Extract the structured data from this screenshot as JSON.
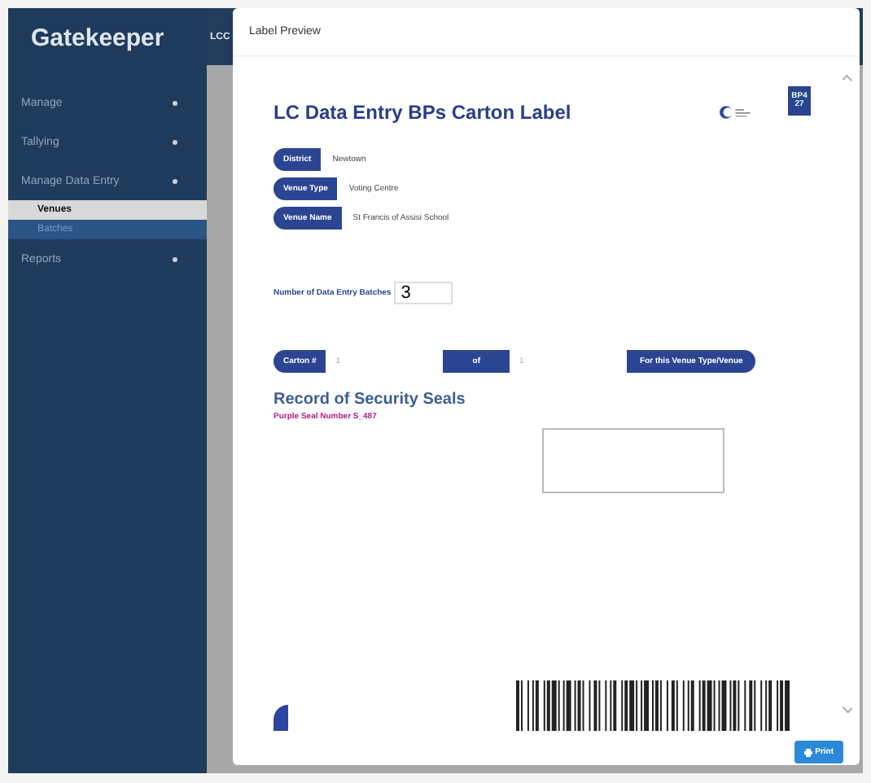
{
  "app": {
    "title": "Gatekeeper",
    "header_text": "LCC"
  },
  "sidebar": {
    "items": [
      {
        "label": "Manage",
        "selected": false
      },
      {
        "label": "Tallying",
        "selected": false
      },
      {
        "label": "Manage Data Entry",
        "selected": false,
        "children": [
          {
            "label": "Venues",
            "selected": true
          },
          {
            "label": "Batches",
            "selected": false
          }
        ]
      },
      {
        "label": "Reports",
        "selected": false
      }
    ]
  },
  "dialog": {
    "title": "Label Preview",
    "label": {
      "heading": "LC Data Entry BPs Carton Label",
      "tag": "BP427",
      "fields": [
        {
          "name": "District",
          "value": "Newtown"
        },
        {
          "name": "Venue Type",
          "value": "Voting Centre"
        },
        {
          "name": "Venue Name",
          "value": "St Francis of Assisi School"
        }
      ],
      "batches": {
        "label": "Number of Data Entry Batches",
        "value": "3"
      },
      "carton": {
        "label": "Carton #",
        "number": "1",
        "of_label": "of",
        "total": "1",
        "note": "For this Venue Type/Venue"
      },
      "seals": {
        "heading": "Record of Security Seals",
        "purple_seal": "Purple Seal Number S_487"
      }
    },
    "buttons": [
      "Print"
    ]
  }
}
